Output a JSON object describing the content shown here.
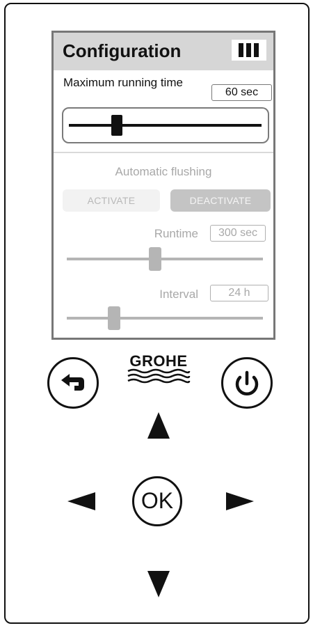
{
  "config": {
    "title": "Configuration",
    "max_runtime": {
      "label": "Maximum running time",
      "value": "60 sec",
      "slider_fraction": 0.25
    },
    "auto_flush": {
      "label": "Automatic flushing",
      "activate_label": "ACTIVATE",
      "deactivate_label": "DEACTIVATE",
      "runtime": {
        "label": "Runtime",
        "value": "300 sec",
        "slider_fraction": 0.45
      },
      "interval": {
        "label": "Interval",
        "value": "24 h",
        "slider_fraction": 0.24
      }
    }
  },
  "controls": {
    "brand": "GROHE",
    "ok_label": "OK"
  },
  "icons": {
    "header": "signal-bars-icon",
    "back": "back-arrow-icon",
    "power": "power-icon",
    "up": "arrow-up-icon",
    "left": "arrow-left-icon",
    "right": "arrow-right-icon",
    "down": "arrow-down-icon"
  },
  "colors": {
    "header_bg": "#d6d6d6",
    "disabled_text": "#a8a8a8",
    "active_button": "#c4c4c4"
  }
}
